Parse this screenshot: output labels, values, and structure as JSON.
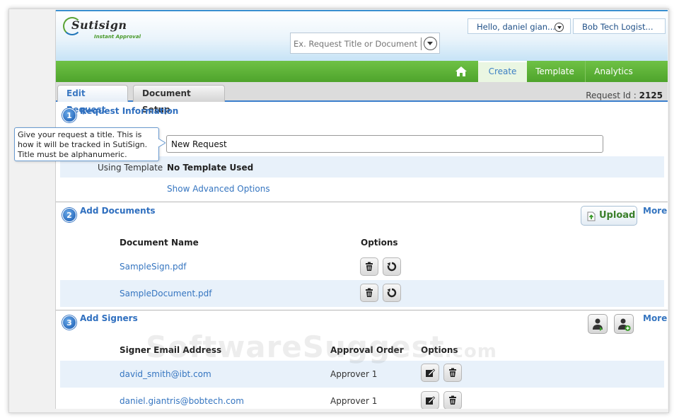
{
  "header": {
    "logo_text": "Sutisign",
    "logo_tagline": "Instant Approval",
    "search_placeholder": "Ex. Request Title or Document N",
    "user_greeting": "Hello, daniel gian...",
    "company": "Bob Tech Logist..."
  },
  "nav": {
    "tabs": [
      {
        "label": "Create"
      },
      {
        "label": "Template"
      },
      {
        "label": "Analytics"
      }
    ]
  },
  "subtabs": {
    "edit_request": "Edit Request",
    "document_setup": "Document Setup",
    "request_id_label": "Request Id :",
    "request_id_value": "2125"
  },
  "section1": {
    "number": "1",
    "title": "Request Information",
    "title_value": "New Request",
    "tooltip": "Give your request a title. This is how it will be tracked in SutiSign. Title must be alphanumeric.",
    "template_label": "Using Template",
    "template_value": "No Template Used",
    "advanced_link": "Show Advanced Options"
  },
  "section2": {
    "number": "2",
    "title": "Add Documents",
    "upload_label": "Upload",
    "more": "More",
    "col_name": "Document Name",
    "col_options": "Options",
    "documents": [
      {
        "name": "SampleSign.pdf"
      },
      {
        "name": "SampleDocument.pdf"
      }
    ]
  },
  "section3": {
    "number": "3",
    "title": "Add Signers",
    "more": "More",
    "col_email": "Signer Email Address",
    "col_order": "Approval Order",
    "col_options": "Options",
    "signers": [
      {
        "email": "david_smith@ibt.com",
        "order": "Approver 1"
      },
      {
        "email": "daniel.giantris@bobtech.com",
        "order": "Approver 1"
      }
    ]
  },
  "watermark": {
    "main": "SoftwareSuggest",
    "suffix": ".com"
  }
}
